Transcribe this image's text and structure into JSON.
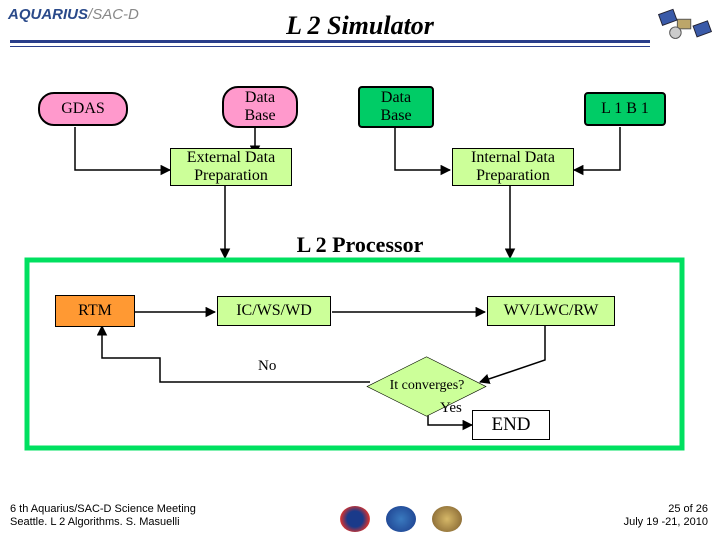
{
  "header": {
    "logo_main": "AQUARIUS",
    "logo_sep": "/",
    "logo_sub": "SAC-D",
    "title": "L 2 Simulator"
  },
  "nodes": {
    "gdas": "GDAS",
    "db1": "Data\nBase",
    "db2": "Data\nBase",
    "l1b1": "L 1 B 1",
    "ext": "External Data\nPreparation",
    "int": "Internal Data\nPreparation",
    "l2proc": "L 2 Processor",
    "rtm": "RTM",
    "icwswd": "IC/WS/WD",
    "wvlwcrw": "WV/LWC/RW",
    "converge": "It converges?",
    "no": "No",
    "yes": "Yes",
    "end": "END"
  },
  "footer": {
    "left_line1": "6 th Aquarius/SAC-D Science Meeting",
    "left_line2": "Seattle. L 2 Algorithms. S. Masuelli",
    "right_line1": "25 of  26",
    "right_line2": "July 19 -21, 2010"
  }
}
